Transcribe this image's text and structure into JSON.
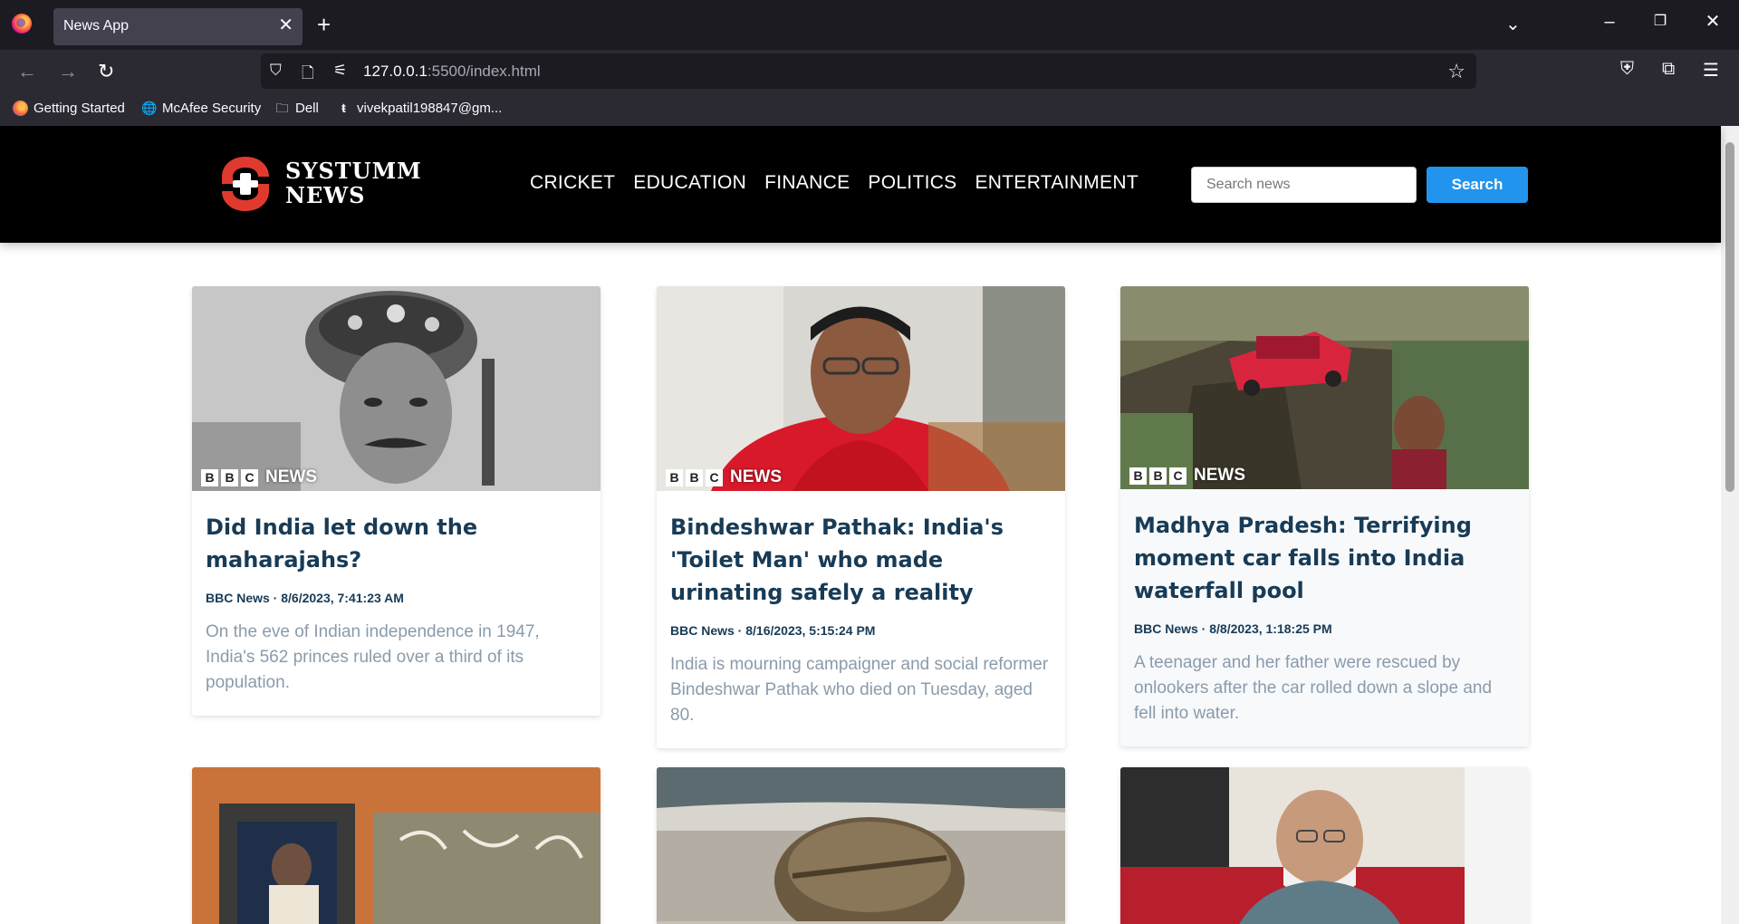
{
  "browser": {
    "tab_title": "News App",
    "url_host": "127.0.0.1",
    "url_rest": ":5500/index.html",
    "bookmarks": [
      {
        "label": "Getting Started",
        "icon": "firefox-icon"
      },
      {
        "label": "McAfee Security",
        "icon": "globe-icon"
      },
      {
        "label": "Dell",
        "icon": "folder-icon"
      },
      {
        "label": "vivekpatil198847@gm...",
        "icon": "site-icon"
      }
    ]
  },
  "site": {
    "logo_line1": "SYSTUMM",
    "logo_line2": "NEWS",
    "nav": [
      "CRICKET",
      "EDUCATION",
      "FINANCE",
      "POLITICS",
      "ENTERTAINMENT"
    ],
    "search_placeholder": "Search news",
    "search_button": "Search"
  },
  "articles": [
    {
      "title": "Did India let down the maharajahs?",
      "meta": "BBC News · 8/6/2023, 7:41:23 AM",
      "desc": "On the eve of Indian independence in 1947, India's 562 princes ruled over a third of its population.",
      "badge": "NEWS"
    },
    {
      "title": "Bindeshwar Pathak: India's 'Toilet Man' who made urinating safely a reality",
      "meta": "BBC News · 8/16/2023, 5:15:24 PM",
      "desc": "India is mourning campaigner and social reformer Bindeshwar Pathak who died on Tuesday, aged 80.",
      "badge": "NEWS"
    },
    {
      "title": "Madhya Pradesh: Terrifying moment car falls into India waterfall pool",
      "meta": "BBC News · 8/8/2023, 1:18:25 PM",
      "desc": "A teenager and her father were rescued by onlookers after the car rolled down a slope and fell into water.",
      "badge": "NEWS"
    }
  ],
  "colors": {
    "accent": "#2294ed",
    "title": "#183b56",
    "desc": "#8a9bab",
    "header_bg": "#000000"
  }
}
